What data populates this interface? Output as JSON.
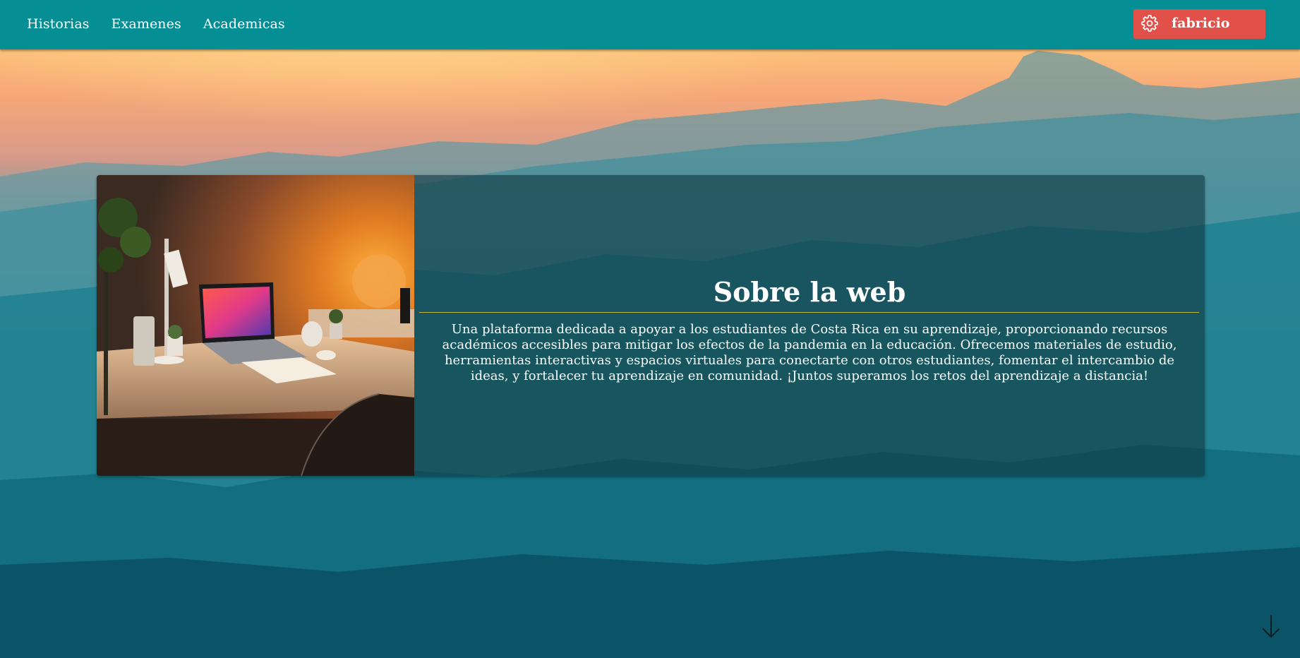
{
  "navbar": {
    "links": [
      {
        "label": "Historias"
      },
      {
        "label": "Examenes"
      },
      {
        "label": "Academicas"
      }
    ],
    "user": {
      "name": "fabricio",
      "icon": "gear-icon"
    }
  },
  "card": {
    "title": "Sobre la web",
    "body": "Una plataforma dedicada a apoyar a los estudiantes de Costa Rica en su aprendizaje, proporcionando recursos académicos accesibles para mitigar los efectos de la pandemia en la educación. Ofrecemos materiales de estudio, herramientas interactivas y espacios virtuales para conectarte con otros estudiantes, fomentar el intercambio de ideas, y fortalecer tu aprendizaje en comunidad. ¡Juntos superamos los retos del aprendizaje a distancia!",
    "image": "desk-laptop-photo"
  },
  "scroll": {
    "icon": "arrow-down-icon"
  },
  "colors": {
    "navbar": "#058f95",
    "user_button": "#e2504a",
    "divider": "#c7b440",
    "card_overlay": "#103840"
  }
}
